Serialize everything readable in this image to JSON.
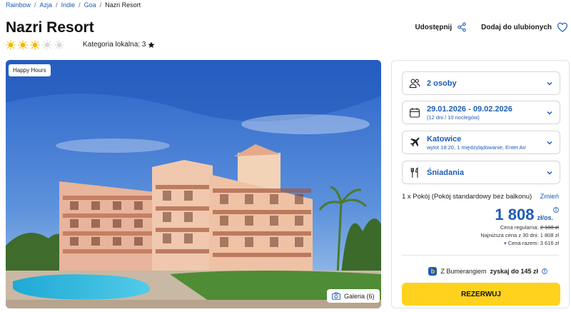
{
  "breadcrumb": [
    "Rainbow",
    "Azja",
    "Indie",
    "Goa",
    "Nazri Resort"
  ],
  "hotel": {
    "name": "Nazri Resort",
    "stars": 3,
    "stars_max": 5,
    "category_label": "Kategoria lokalna: 3",
    "badge": "Happy Hours",
    "gallery_label": "Galeria (6)"
  },
  "actions": {
    "share": "Udostępnij",
    "favorite": "Dodaj do ulubionych"
  },
  "booking": {
    "persons": "2 osoby",
    "dates": "29.01.2026 - 09.02.2026",
    "dates_sub": "(12 dni / 10 noclegów)",
    "departure": "Katowice",
    "departure_sub": "wylot 18:20, 1 międzylądowanie, Enter Air",
    "meal": "Śniadania",
    "room": "1 x Pokój  (Pokój standardowy bez balkonu)",
    "change": "Zmień",
    "price": "1 808",
    "price_unit": "zł/os.",
    "regular_label": "Cena regularna:",
    "regular_price": "2 108 zł",
    "lowest_30": "Najniższa cena z 30 dni: 1 808 zł",
    "total": "Cena razem: 3 616 zł",
    "bumerang_prefix": "Z Bumerangiem",
    "bumerang_bold": "zyskaj do 145 zł",
    "bumerang_logo": "b",
    "reserve": "REZERWUJ"
  },
  "colors": {
    "accent": "#1e5bb8",
    "button": "#ffd21e",
    "sun": "#f5b800"
  }
}
